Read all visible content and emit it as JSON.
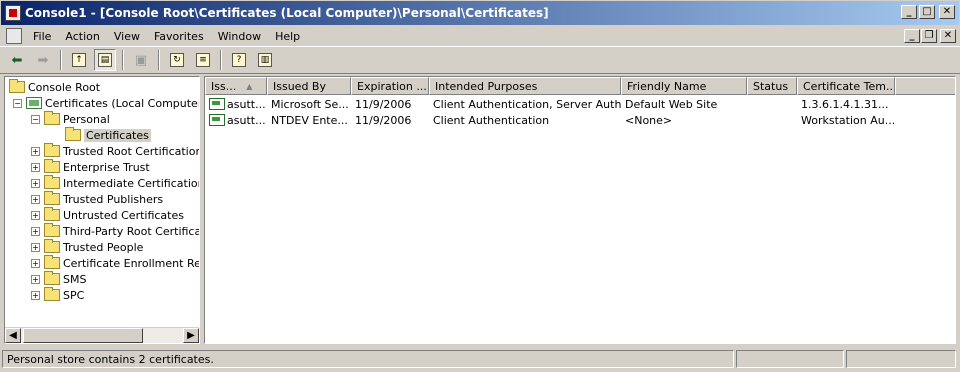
{
  "window": {
    "title": "Console1 - [Console Root\\Certificates (Local Computer)\\Personal\\Certificates]",
    "minimize": "_",
    "maximize": "□",
    "close": "✕"
  },
  "menu": {
    "items": [
      "File",
      "Action",
      "View",
      "Favorites",
      "Window",
      "Help"
    ],
    "mdi_minimize": "_",
    "mdi_restore": "❐",
    "mdi_close": "✕"
  },
  "toolbar": {
    "icons": [
      "back-arrow-icon",
      "forward-arrow-icon",
      "up-one-level-icon",
      "show-hide-tree-icon",
      "delete-icon",
      "refresh-icon",
      "export-list-icon",
      "help-icon",
      "show-hide-action-pane-icon"
    ]
  },
  "tree": {
    "root": "Console Root",
    "certificates_node": "Certificates (Local Computer)",
    "personal": "Personal",
    "personal_certificates": "Certificates",
    "children": [
      "Trusted Root Certification A",
      "Enterprise Trust",
      "Intermediate Certification A",
      "Trusted Publishers",
      "Untrusted Certificates",
      "Third-Party Root Certificatio",
      "Trusted People",
      "Certificate Enrollment Requ",
      "SMS",
      "SPC"
    ]
  },
  "list": {
    "columns": [
      "Iss...",
      "Issued By",
      "Expiration ...",
      "Intended Purposes",
      "Friendly Name",
      "Status",
      "Certificate Tem..."
    ],
    "sort_indicator": "▲",
    "rows": [
      [
        "asutt...",
        "Microsoft Se...",
        "11/9/2006",
        "Client Authentication, Server Auth...",
        "Default Web Site",
        "",
        "1.3.6.1.4.1.31..."
      ],
      [
        "asutt...",
        "NTDEV Ente...",
        "11/9/2006",
        "Client Authentication",
        "<None>",
        "",
        "Workstation Au..."
      ]
    ]
  },
  "status": {
    "text": "Personal store contains 2 certificates."
  },
  "colors": {
    "title_start": "#0a246a",
    "title_end": "#a6caf0",
    "face": "#d4d0c8"
  }
}
